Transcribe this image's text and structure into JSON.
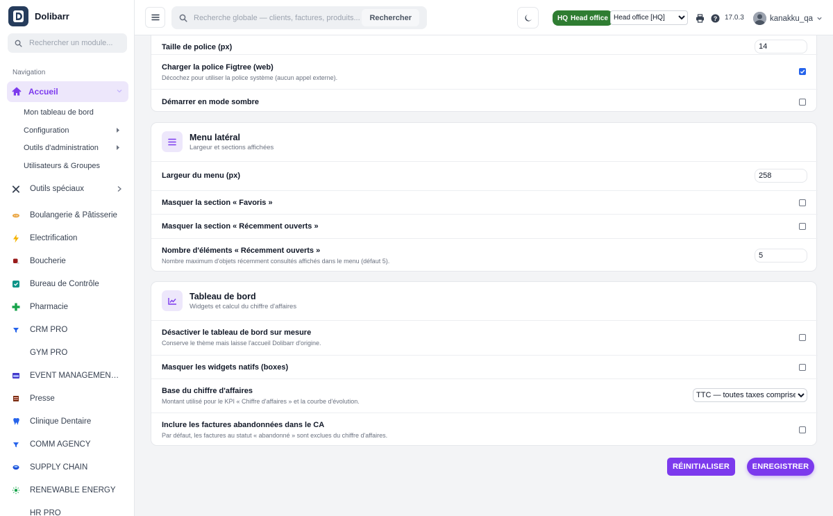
{
  "brand": {
    "name": "Dolibarr",
    "logo_letter": "D"
  },
  "sidebar": {
    "search_placeholder": "Rechercher un module...",
    "nav_heading": "Navigation",
    "active": {
      "label": "Accueil",
      "icon": "home-icon"
    },
    "sub_items": [
      {
        "label": "Mon tableau de bord",
        "has_arrow": false
      },
      {
        "label": "Configuration",
        "has_arrow": true
      },
      {
        "label": "Outils d'administration",
        "has_arrow": true
      },
      {
        "label": "Utilisateurs & Groupes",
        "has_arrow": false
      }
    ],
    "modules": [
      {
        "label": "Outils spéciaux",
        "icon": "tools-icon",
        "color": "#374151",
        "has_arrow": true
      },
      {
        "label": "Boulangerie & Pâtisserie",
        "icon": "bread-icon",
        "color": "#e9a23b",
        "has_arrow": false
      },
      {
        "label": "Electrification",
        "icon": "lightning-icon",
        "color": "#f5b301",
        "has_arrow": false
      },
      {
        "label": "Boucherie",
        "icon": "meat-icon",
        "color": "#991b1b",
        "has_arrow": false
      },
      {
        "label": "Bureau de Contrôle",
        "icon": "shield-check-icon",
        "color": "#0d9488",
        "has_arrow": false
      },
      {
        "label": "Pharmacie",
        "icon": "cross-icon",
        "color": "#16a34a",
        "has_arrow": false
      },
      {
        "label": "CRM PRO",
        "icon": "funnel-icon",
        "color": "#2563eb",
        "has_arrow": false
      },
      {
        "label": "GYM PRO",
        "icon": "",
        "color": "#374151",
        "has_arrow": false
      },
      {
        "label": "EVENT MANAGEMENT P...",
        "icon": "calendar-icon",
        "color": "#4338ca",
        "has_arrow": false
      },
      {
        "label": "Presse",
        "icon": "newspaper-icon",
        "color": "#7c2d12",
        "has_arrow": false
      },
      {
        "label": "Clinique Dentaire",
        "icon": "tooth-icon",
        "color": "#2563eb",
        "has_arrow": false
      },
      {
        "label": "COMM AGENCY",
        "icon": "funnel-icon",
        "color": "#2563eb",
        "has_arrow": false
      },
      {
        "label": "SUPPLY CHAIN",
        "icon": "truck-icon",
        "color": "#1d4ed8",
        "has_arrow": false
      },
      {
        "label": "RENEWABLE ENERGY",
        "icon": "sun-icon",
        "color": "#16a34a",
        "has_arrow": false
      },
      {
        "label": "HR PRO",
        "icon": "",
        "color": "#374151",
        "has_arrow": false
      }
    ]
  },
  "topbar": {
    "search_placeholder": "Recherche globale — clients, factures, produits...",
    "search_button": "Rechercher",
    "entity_badge_code": "HQ",
    "entity_badge_name": "Head office",
    "entity_select_value": "Head office [HQ]",
    "version": "17.0.3",
    "username": "kanakku_qa",
    "colors": {
      "badge": "#2f7d32",
      "accent": "#7c3aed"
    }
  },
  "card1": {
    "rows": [
      {
        "label": "Taille de police (px)",
        "desc": "",
        "type": "number",
        "value": "14"
      },
      {
        "label": "Charger la police Figtree (web)",
        "desc": "Décochez pour utiliser la police système (aucun appel externe).",
        "type": "checkbox",
        "checked": true
      },
      {
        "label": "Démarrer en mode sombre",
        "desc": "",
        "type": "checkbox",
        "checked": false
      }
    ]
  },
  "card2": {
    "title": "Menu latéral",
    "subtitle": "Largeur et sections affichées",
    "icon": "menu-lines-icon",
    "rows": [
      {
        "label": "Largeur du menu (px)",
        "desc": "",
        "type": "number",
        "value": "258"
      },
      {
        "label": "Masquer la section « Favoris »",
        "desc": "",
        "type": "checkbox",
        "checked": false
      },
      {
        "label": "Masquer la section « Récemment ouverts »",
        "desc": "",
        "type": "checkbox",
        "checked": false
      },
      {
        "label": "Nombre d'éléments « Récemment ouverts »",
        "desc": "Nombre maximum d'objets récemment consultés affichés dans le menu (défaut 5).",
        "type": "number",
        "value": "5"
      }
    ]
  },
  "card3": {
    "title": "Tableau de bord",
    "subtitle": "Widgets et calcul du chiffre d'affaires",
    "icon": "trend-chart-icon",
    "rows": [
      {
        "label": "Désactiver le tableau de bord sur mesure",
        "desc": "Conserve le thème mais laisse l'accueil Dolibarr d'origine.",
        "type": "checkbox",
        "checked": false
      },
      {
        "label": "Masquer les widgets natifs (boxes)",
        "desc": "",
        "type": "checkbox",
        "checked": false
      },
      {
        "label": "Base du chiffre d'affaires",
        "desc": "Montant utilisé pour le KPI « Chiffre d'affaires » et la courbe d'évolution.",
        "type": "select",
        "value": "TTC — toutes taxes comprises"
      },
      {
        "label": "Inclure les factures abandonnées dans le CA",
        "desc": "Par défaut, les factures au statut « abandonné » sont exclues du chiffre d'affaires.",
        "type": "checkbox",
        "checked": false
      }
    ]
  },
  "actions": {
    "reset_label": "RÉINITIALISER",
    "save_label": "ENREGISTRER"
  }
}
